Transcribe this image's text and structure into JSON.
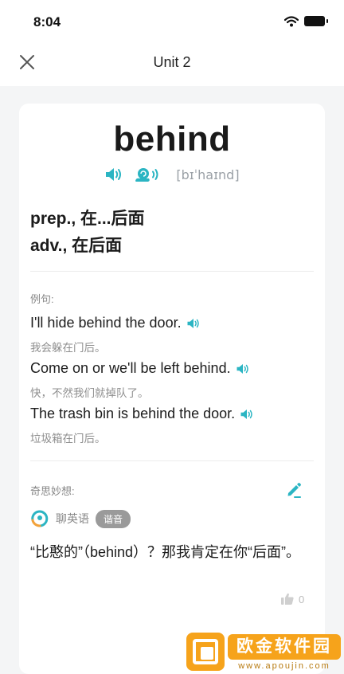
{
  "status": {
    "time": "8:04"
  },
  "nav": {
    "title": "Unit 2"
  },
  "word": {
    "text": "behind",
    "phonetic": "[bɪˈhaɪnd]",
    "definitions": [
      "prep., 在...后面",
      "adv., 在后面"
    ]
  },
  "examples": {
    "label": "例句:",
    "items": [
      {
        "en": "I'll hide behind the door.",
        "zh": "我会躲在门后。"
      },
      {
        "en": "Come on or we'll be left behind.",
        "zh": "快，不然我们就掉队了。"
      },
      {
        "en": "The trash bin is behind the door.",
        "zh": "垃圾箱在门后。"
      }
    ]
  },
  "idea": {
    "label": "奇思妙想:",
    "user": "聊英语",
    "badge": "谐音",
    "comment": "“比憨的”（behind）？那我肯定在你“后面”。",
    "likes": "0"
  },
  "watermark": {
    "text": "欧金软件园",
    "url": "www.apoujin.com"
  },
  "colors": {
    "accent": "#2bb5c3",
    "watermark": "#f6a31b"
  },
  "icons": [
    "close-icon",
    "speaker-icon",
    "snail-speaker-icon",
    "pencil-icon",
    "thumbs-up-icon",
    "wifi-icon",
    "battery-icon"
  ]
}
